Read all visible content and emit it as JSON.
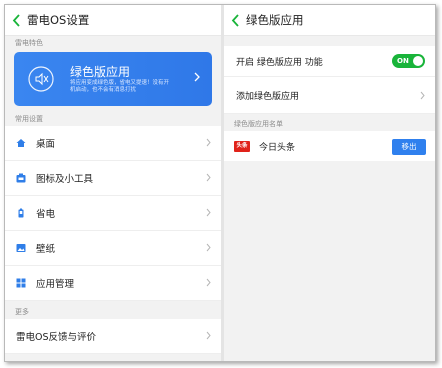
{
  "left": {
    "title": "雷电OS设置",
    "section_feature": "雷电特色",
    "feature": {
      "title": "绿色版应用",
      "desc": "将应用变成绿色版，省电又提速！没有开机启动，也不会有消息打扰"
    },
    "section_common": "常用设置",
    "common_items": [
      {
        "label": "桌面",
        "icon": "home-icon"
      },
      {
        "label": "图标及小工具",
        "icon": "widget-icon"
      },
      {
        "label": "省电",
        "icon": "battery-icon"
      },
      {
        "label": "壁纸",
        "icon": "wallpaper-icon"
      },
      {
        "label": "应用管理",
        "icon": "apps-grid-icon"
      }
    ],
    "section_more": "更多",
    "more_items": [
      {
        "label": "雷电OS反馈与评价"
      }
    ]
  },
  "right": {
    "title": "绿色版应用",
    "toggle_label": "开启 绿色版应用 功能",
    "toggle_state": "ON",
    "add_label": "添加绿色版应用",
    "list_header": "绿色版应用名单",
    "apps": [
      {
        "icon_text": "头条",
        "name": "今日头条",
        "action": "移出"
      }
    ]
  },
  "colors": {
    "accent_blue": "#2f80ee",
    "toggle_green": "#19b43a",
    "back_green": "#19b43a",
    "icon_blue": "#2f7ee8",
    "app_red": "#e0221a"
  }
}
